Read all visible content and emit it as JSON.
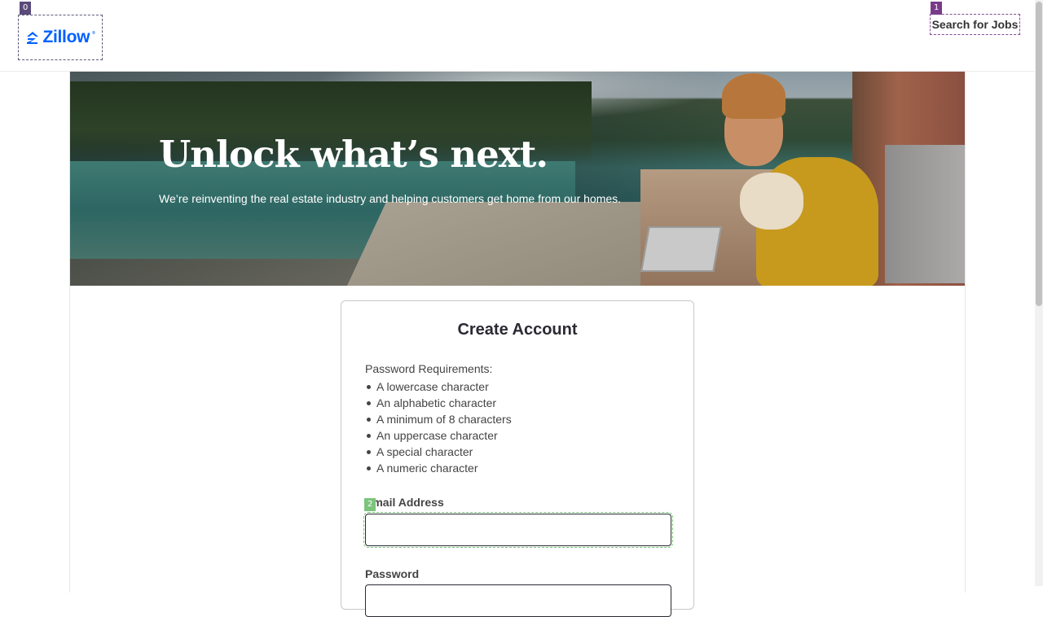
{
  "header": {
    "logo_text": "Zillow",
    "logo_mark": "®",
    "jobs_link": "Search for Jobs"
  },
  "overlay_tags": [
    "0",
    "1",
    "2"
  ],
  "hero": {
    "title": "Unlock what’s next.",
    "subtitle": "We’re reinventing the real estate industry and helping customers get home from our homes."
  },
  "form": {
    "title": "Create Account",
    "requirements_heading": "Password Requirements:",
    "requirements": [
      "A lowercase character",
      "An alphabetic character",
      "A minimum of 8 characters",
      "An uppercase character",
      "A special character",
      "A numeric character"
    ],
    "email_label": "Email Address",
    "email_value": "",
    "password_label": "Password",
    "password_value": ""
  },
  "colors": {
    "brand": "#0061ff",
    "text": "#2a2a33"
  },
  "icons": {
    "logo": "zillow-home-icon"
  }
}
